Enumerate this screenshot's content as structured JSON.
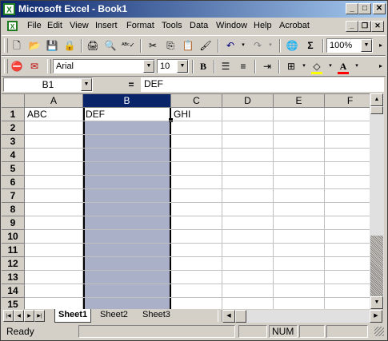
{
  "window": {
    "title": "Microsoft Excel - Book1"
  },
  "menu": {
    "items": [
      {
        "label": "File"
      },
      {
        "label": "Edit"
      },
      {
        "label": "View"
      },
      {
        "label": "Insert"
      },
      {
        "label": "Format"
      },
      {
        "label": "Tools"
      },
      {
        "label": "Data"
      },
      {
        "label": "Window"
      },
      {
        "label": "Help"
      },
      {
        "label": "Acrobat"
      }
    ]
  },
  "toolbar": {
    "zoom": "100%"
  },
  "formatting": {
    "font": "Arial",
    "size": "10"
  },
  "formula_bar": {
    "name_box": "B1",
    "equals": "=",
    "content": "DEF"
  },
  "sheet": {
    "columns": [
      "A",
      "B",
      "C",
      "D",
      "E",
      "F"
    ],
    "rows": [
      "1",
      "2",
      "3",
      "4",
      "5",
      "6",
      "7",
      "8",
      "9",
      "10",
      "11",
      "12",
      "13",
      "14",
      "15"
    ],
    "cells": {
      "A1": "ABC",
      "B1": "DEF",
      "C1": "GHI"
    },
    "selected_column": "B"
  },
  "tabs": [
    "Sheet1",
    "Sheet2",
    "Sheet3"
  ],
  "active_tab": "Sheet1",
  "status": {
    "left": "Ready",
    "num": "NUM"
  },
  "colors": {
    "title_start": "#0a246a",
    "title_end": "#a6caf0",
    "selection": "#a9b0c8",
    "selected_header": "#0a246a"
  },
  "icons": {
    "standard": [
      "new-icon",
      "open-icon",
      "save-icon",
      "permission-icon",
      "print-icon",
      "print-preview-icon",
      "spelling-icon",
      "cut-icon",
      "copy-icon",
      "paste-icon",
      "format-painter-icon",
      "undo-icon",
      "redo-icon",
      "hyperlink-icon",
      "autosum-icon"
    ],
    "formatting": [
      "pdf-convert-icon",
      "pdf-email-icon",
      "bold-icon",
      "align-left-icon",
      "center-icon",
      "increase-indent-icon",
      "borders-icon",
      "fill-color-icon",
      "font-color-icon"
    ]
  }
}
